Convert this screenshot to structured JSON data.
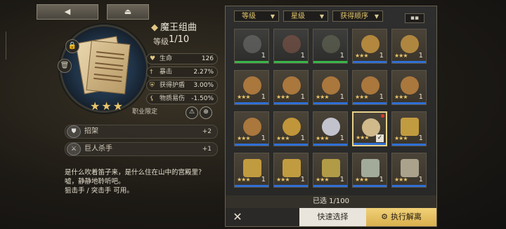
{
  "top_buttons": {
    "back": "◀",
    "eject": "⏏"
  },
  "item": {
    "name": "魔王组曲",
    "level_label": "等级",
    "level_value": "1/10",
    "stars": "★★★",
    "stats": [
      {
        "icon": "heart-icon",
        "label": "生命",
        "value": "126"
      },
      {
        "icon": "sword-icon",
        "label": "暴击",
        "value": "2.27%"
      },
      {
        "icon": "shield-icon",
        "label": "获得护盾",
        "value": "3.00%"
      },
      {
        "icon": "claw-icon",
        "label": "物质易伤",
        "value": "-1.50%"
      }
    ],
    "job_label": "职业限定",
    "skills": [
      {
        "name": "招架",
        "bonus": "+2"
      },
      {
        "name": "巨人杀手",
        "bonus": "+1"
      }
    ],
    "description": "是什么吹着笛子来，是什么住在山中的宫殿里？嘘，静静地聆听吧。",
    "usable": "狙击手 / 突击手 可用。"
  },
  "filters": [
    {
      "label": "等级"
    },
    {
      "label": "星级"
    },
    {
      "label": "获得顺序"
    }
  ],
  "grid_icon": "grid-icon",
  "inventory": [
    {
      "kind": "grey",
      "art": "book",
      "stars": "",
      "count": "1",
      "bar": "#39b54a"
    },
    {
      "kind": "grey",
      "art": "flowers",
      "stars": "",
      "count": "1",
      "bar": "#39b54a"
    },
    {
      "kind": "grey",
      "art": "plant",
      "stars": "",
      "count": "1",
      "bar": "#39b54a"
    },
    {
      "kind": "gold",
      "art": "frog",
      "stars": "★★★",
      "count": "1",
      "bar": "#2f6fd6"
    },
    {
      "kind": "gold",
      "art": "bird",
      "stars": "★★★",
      "count": "1",
      "bar": "#2f6fd6"
    },
    {
      "kind": "gold",
      "art": "bear",
      "stars": "★★★",
      "count": "1",
      "bar": "#2f6fd6"
    },
    {
      "kind": "gold",
      "art": "bear",
      "stars": "★★★",
      "count": "1",
      "bar": "#2f6fd6"
    },
    {
      "kind": "gold",
      "art": "bear",
      "stars": "★★★",
      "count": "1",
      "bar": "#2f6fd6"
    },
    {
      "kind": "gold",
      "art": "bear",
      "stars": "★★★",
      "count": "1",
      "bar": "#2f6fd6"
    },
    {
      "kind": "gold",
      "art": "bear",
      "stars": "★★★",
      "count": "1",
      "bar": "#2f6fd6"
    },
    {
      "kind": "gold",
      "art": "bear",
      "stars": "★★★",
      "count": "1",
      "bar": "#2f6fd6"
    },
    {
      "kind": "gold",
      "art": "statue",
      "stars": "★★★",
      "count": "1",
      "bar": "#2f6fd6"
    },
    {
      "kind": "gold",
      "art": "doll",
      "stars": "★★★",
      "count": "1",
      "bar": "#2f6fd6"
    },
    {
      "kind": "gold",
      "art": "paper",
      "stars": "★★★",
      "count": "",
      "bar": "#2f6fd6",
      "selected": true
    },
    {
      "kind": "gold",
      "art": "key-red",
      "stars": "★★★",
      "count": "1",
      "bar": "#2f6fd6"
    },
    {
      "kind": "gold",
      "art": "key-red",
      "stars": "★★★",
      "count": "1",
      "bar": "#2f6fd6"
    },
    {
      "kind": "gold",
      "art": "key-red",
      "stars": "★★★",
      "count": "1",
      "bar": "#2f6fd6"
    },
    {
      "kind": "gold",
      "art": "key-green",
      "stars": "★★★",
      "count": "1",
      "bar": "#2f6fd6"
    },
    {
      "kind": "gold",
      "art": "key-teal",
      "stars": "★★★",
      "count": "1",
      "bar": "#2f6fd6"
    },
    {
      "kind": "gold",
      "art": "key-grey",
      "stars": "★★★",
      "count": "1",
      "bar": "#2f6fd6"
    }
  ],
  "selection_count": "已选 1/100",
  "actions": {
    "close": "✕",
    "quick_select": "快速选择",
    "execute": "执行解离"
  },
  "colors": {
    "accent_gold": "#e9c56a",
    "exec_button": "#e2bd5c",
    "quick_button": "#e9e5dc"
  }
}
